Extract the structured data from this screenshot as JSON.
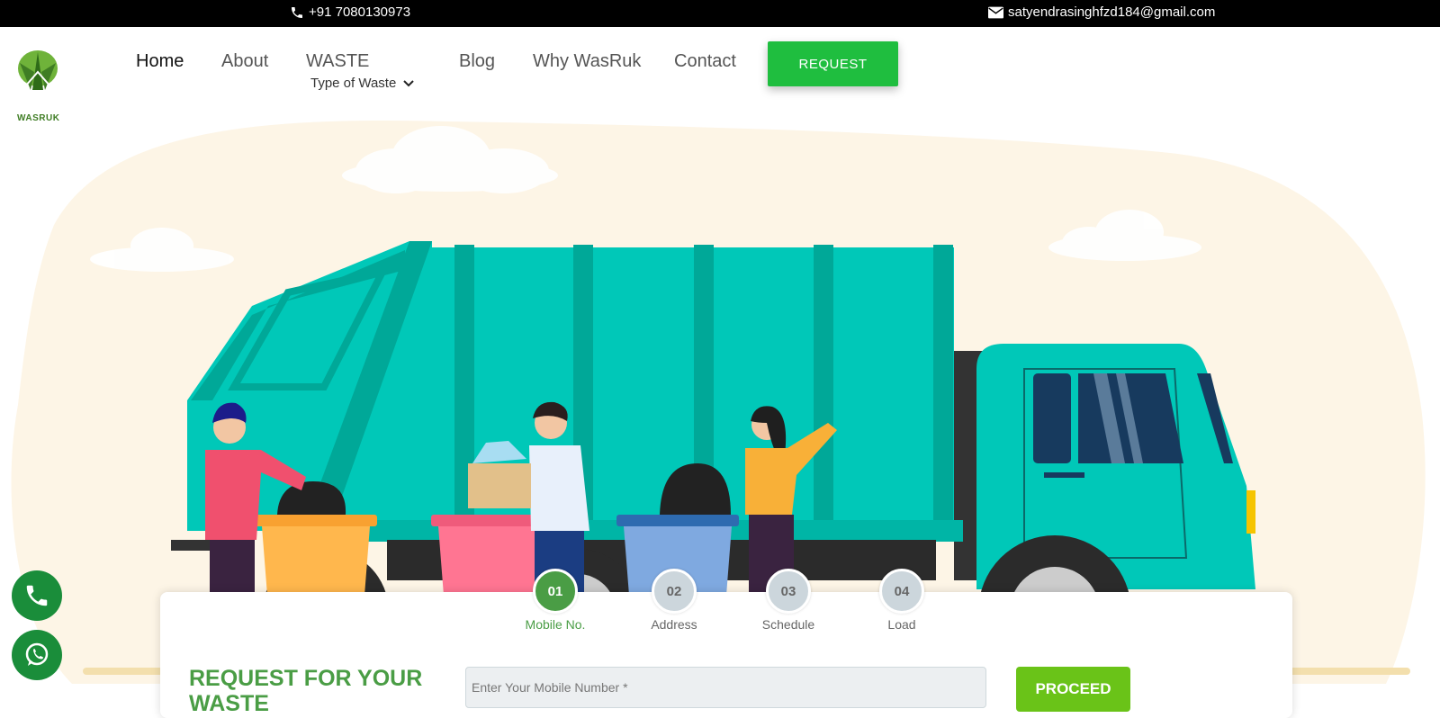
{
  "topbar": {
    "phone": "+91 7080130973",
    "email": "satyendrasinghfzd184@gmail.com",
    "phone_icon": "phone-icon",
    "email_icon": "envelope-icon"
  },
  "brand": {
    "logo_text": "WASRUK",
    "color": "#3f7d24"
  },
  "nav": {
    "items": [
      {
        "label": "Home",
        "active": true
      },
      {
        "label": "About"
      },
      {
        "label": "WASTE"
      },
      {
        "label": "Blog"
      },
      {
        "label": "Why WasRuk"
      },
      {
        "label": "Contact"
      }
    ],
    "submenu_label": "Type of Waste",
    "request_label": "REQUEST"
  },
  "steps": [
    {
      "num": "01",
      "label": "Mobile No.",
      "active": true
    },
    {
      "num": "02",
      "label": "Address"
    },
    {
      "num": "03",
      "label": "Schedule"
    },
    {
      "num": "04",
      "label": "Load"
    }
  ],
  "form": {
    "title": "REQUEST FOR YOUR WASTE",
    "placeholder": "Enter Your Mobile Number *",
    "proceed_label": "PROCEED"
  },
  "colors": {
    "accent_green": "#4a9d45",
    "request_green": "#1fbe3f",
    "proceed_green": "#6ac318",
    "truck_teal": "#00c8b8"
  }
}
